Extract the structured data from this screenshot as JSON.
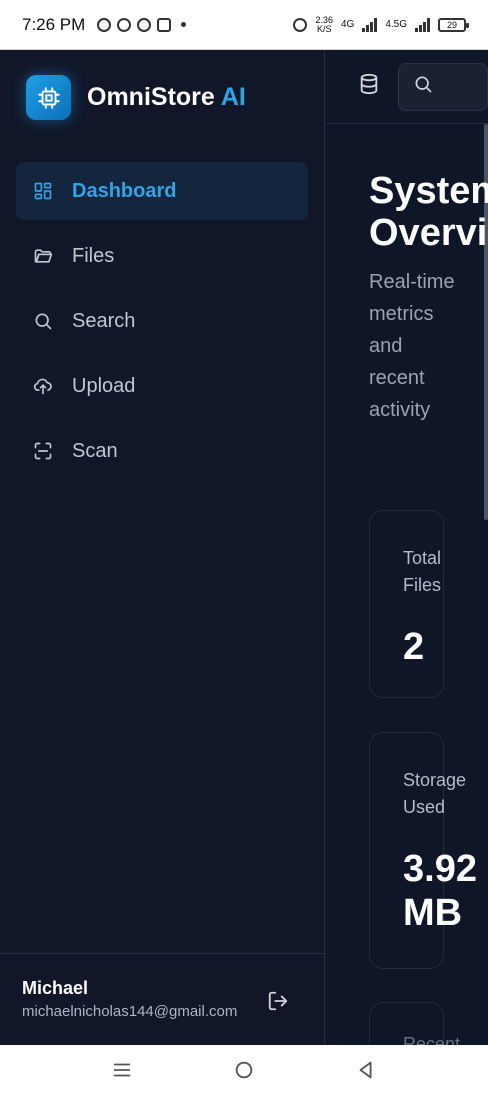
{
  "status_bar": {
    "time": "7:26 PM",
    "net_rate_value": "2.36",
    "net_rate_unit": "K/S",
    "network_a": "4G",
    "network_b": "4.5G",
    "battery": "29"
  },
  "sidebar": {
    "brand_name": "OmniStore",
    "brand_suffix": "AI",
    "items": [
      {
        "label": "Dashboard",
        "icon": "dashboard-icon",
        "active": true
      },
      {
        "label": "Files",
        "icon": "folder-icon",
        "active": false
      },
      {
        "label": "Search",
        "icon": "search-icon",
        "active": false
      },
      {
        "label": "Upload",
        "icon": "upload-cloud-icon",
        "active": false
      },
      {
        "label": "Scan",
        "icon": "scan-icon",
        "active": false
      }
    ],
    "user": {
      "name": "Michael",
      "email": "michaelnicholas144@gmail.com"
    }
  },
  "main": {
    "title": "System Overview",
    "subtitle": "Real-time metrics and recent activity",
    "cards": [
      {
        "label": "Total Files",
        "value": "2"
      },
      {
        "label": "Storage Used",
        "value": "3.92 MB"
      }
    ],
    "partial_card_label": "Recent"
  },
  "colors": {
    "accent": "#29a8e8",
    "sidebar_bg": "#111729",
    "main_bg": "#0f1628"
  }
}
